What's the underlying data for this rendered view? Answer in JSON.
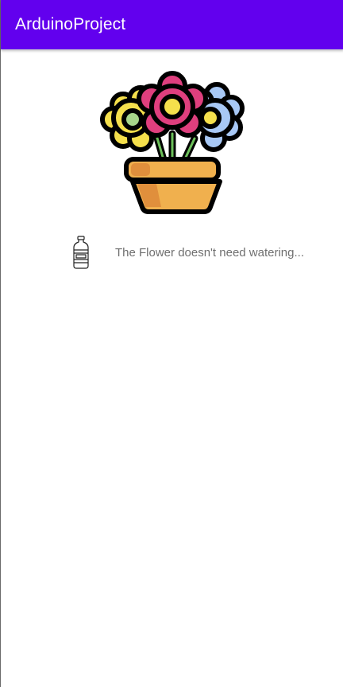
{
  "app_bar": {
    "title": "ArduinoProject",
    "color": "#6200ee"
  },
  "main": {
    "flower_icon": "flower-pot-icon",
    "bottle_icon": "water-bottle-icon",
    "status_text": "The Flower doesn't need watering..."
  }
}
